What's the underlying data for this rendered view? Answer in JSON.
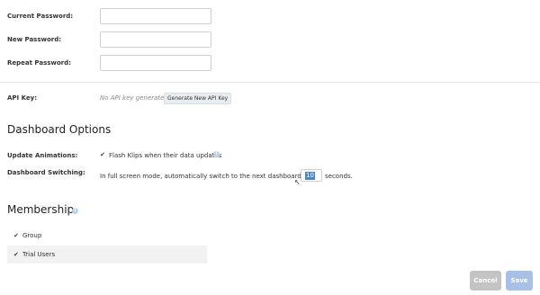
{
  "account": {
    "current_password_label": "Current Password:",
    "new_password_label": "New Password:",
    "repeat_password_label": "Repeat Password:",
    "current_password_value": "",
    "new_password_value": "",
    "repeat_password_value": "",
    "api_key_label": "API Key:",
    "api_key_status": "No API key generated",
    "generate_button": "Generate New API Key"
  },
  "dashboard_options": {
    "title": "Dashboard Options",
    "update_animations_label": "Update Animations:",
    "flash_klips_checked": true,
    "flash_klips_label": "Flash Klips when their data updates",
    "switching_label": "Dashboard Switching:",
    "switching_text_before": "In full screen mode, automatically switch to the next dashboard every",
    "switching_seconds": "10",
    "switching_text_after": "seconds."
  },
  "membership": {
    "title": "Membership",
    "items": [
      {
        "label": "Group",
        "checked": true
      },
      {
        "label": "Trial Users",
        "checked": true
      }
    ]
  },
  "actions": {
    "cancel": "Cancel",
    "save": "Save"
  },
  "icons": {
    "info": "info-icon",
    "checkbox": "checkbox-checked-icon",
    "cursor": "mouse-cursor-icon"
  },
  "colors": {
    "save_button": "#a8c0e6",
    "cancel_button": "#c4c4c4",
    "selection": "#4a87c9"
  }
}
